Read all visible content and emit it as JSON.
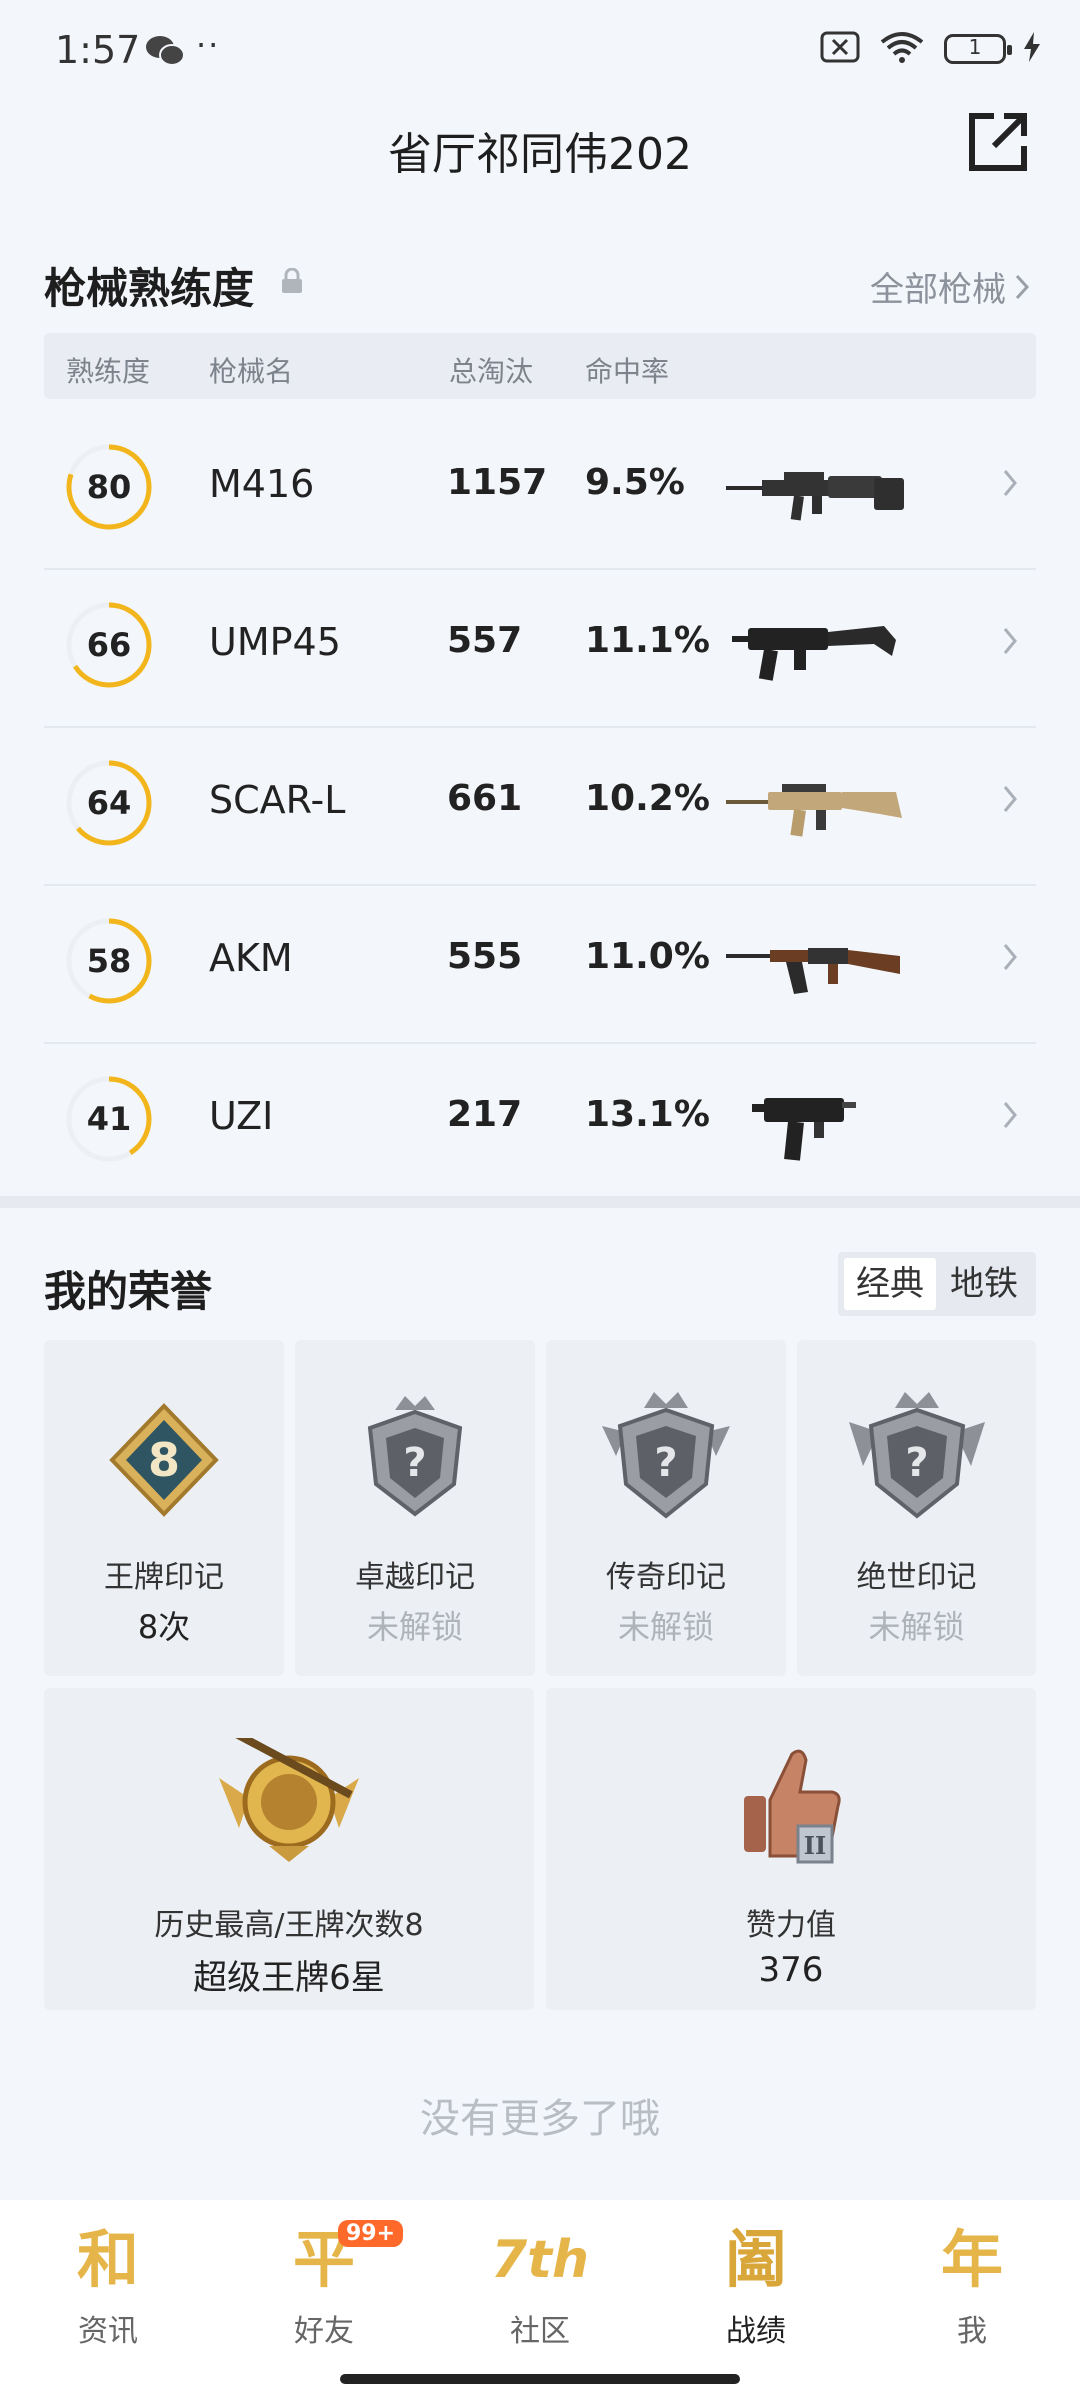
{
  "status_bar": {
    "time": "1:57",
    "dots": "··",
    "battery": "1"
  },
  "header": {
    "title": "省厅祁同伟202"
  },
  "weapons_section": {
    "title": "枪械熟练度",
    "all_link": "全部枪械",
    "columns": [
      "熟练度",
      "枪械名",
      "总淘汰",
      "命中率"
    ],
    "rows": [
      {
        "mastery": "80",
        "mastery_value": 80,
        "name": "M416",
        "kills": "1157",
        "rate": "9.5%"
      },
      {
        "mastery": "66",
        "mastery_value": 66,
        "name": "UMP45",
        "kills": "557",
        "rate": "11.1%"
      },
      {
        "mastery": "64",
        "mastery_value": 64,
        "name": "SCAR-L",
        "kills": "661",
        "rate": "10.2%"
      },
      {
        "mastery": "58",
        "mastery_value": 58,
        "name": "AKM",
        "kills": "555",
        "rate": "11.0%"
      },
      {
        "mastery": "41",
        "mastery_value": 41,
        "name": "UZI",
        "kills": "217",
        "rate": "13.1%"
      }
    ]
  },
  "honor_section": {
    "title": "我的荣誉",
    "tabs": [
      "经典",
      "地铁"
    ],
    "active_tab": "经典",
    "badges": [
      {
        "label": "王牌印记",
        "value": "8次",
        "badge_number": "8"
      },
      {
        "label": "卓越印记",
        "value": "未解锁",
        "badge_number": "?"
      },
      {
        "label": "传奇印记",
        "value": "未解锁",
        "badge_number": "?"
      },
      {
        "label": "绝世印记",
        "value": "未解锁",
        "badge_number": "?"
      }
    ],
    "highest": {
      "label": "历史最高/王牌次数8",
      "value": "超级王牌6星"
    },
    "likes": {
      "label": "赞力值",
      "value": "376"
    }
  },
  "footer_text": "没有更多了哦",
  "bottom_nav": {
    "items": [
      {
        "glyph": "和",
        "label": "资讯"
      },
      {
        "glyph": "平",
        "label": "好友",
        "badge": "99+"
      },
      {
        "glyph": "7th",
        "label": "社区"
      },
      {
        "glyph": "阖",
        "label": "战绩"
      },
      {
        "glyph": "年",
        "label": "我"
      }
    ],
    "active": "战绩"
  },
  "colors": {
    "accent_ring": "#f2b51b",
    "ring_track": "#eceff3",
    "brand_gold": "#e6b54a"
  }
}
